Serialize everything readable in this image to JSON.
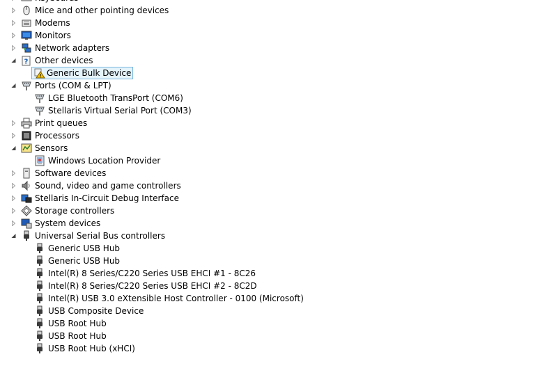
{
  "tree": [
    {
      "label": "Keyboards",
      "level": 0,
      "expander": "collapsed",
      "icon": "keyboard-icon"
    },
    {
      "label": "Mice and other pointing devices",
      "level": 0,
      "expander": "collapsed",
      "icon": "mouse-icon"
    },
    {
      "label": "Modems",
      "level": 0,
      "expander": "collapsed",
      "icon": "modem-icon"
    },
    {
      "label": "Monitors",
      "level": 0,
      "expander": "collapsed",
      "icon": "monitor-icon"
    },
    {
      "label": "Network adapters",
      "level": 0,
      "expander": "collapsed",
      "icon": "network-adapter-icon"
    },
    {
      "label": "Other devices",
      "level": 0,
      "expander": "expanded",
      "icon": "unknown-device-icon"
    },
    {
      "label": "Generic Bulk Device",
      "level": 1,
      "expander": "none",
      "icon": "warning-device-icon",
      "selected": true
    },
    {
      "label": "Ports (COM & LPT)",
      "level": 0,
      "expander": "expanded",
      "icon": "port-icon"
    },
    {
      "label": "LGE Bluetooth TransPort (COM6)",
      "level": 1,
      "expander": "none",
      "icon": "port-icon"
    },
    {
      "label": "Stellaris Virtual Serial Port (COM3)",
      "level": 1,
      "expander": "none",
      "icon": "port-icon"
    },
    {
      "label": "Print queues",
      "level": 0,
      "expander": "collapsed",
      "icon": "printer-icon"
    },
    {
      "label": "Processors",
      "level": 0,
      "expander": "collapsed",
      "icon": "processor-icon"
    },
    {
      "label": "Sensors",
      "level": 0,
      "expander": "expanded",
      "icon": "sensor-icon"
    },
    {
      "label": "Windows Location Provider",
      "level": 1,
      "expander": "none",
      "icon": "location-sensor-icon"
    },
    {
      "label": "Software devices",
      "level": 0,
      "expander": "collapsed",
      "icon": "software-device-icon"
    },
    {
      "label": "Sound, video and game controllers",
      "level": 0,
      "expander": "collapsed",
      "icon": "speaker-icon"
    },
    {
      "label": "Stellaris In-Circuit Debug Interface",
      "level": 0,
      "expander": "collapsed",
      "icon": "debug-interface-icon"
    },
    {
      "label": "Storage controllers",
      "level": 0,
      "expander": "collapsed",
      "icon": "storage-controller-icon"
    },
    {
      "label": "System devices",
      "level": 0,
      "expander": "collapsed",
      "icon": "system-device-icon"
    },
    {
      "label": "Universal Serial Bus controllers",
      "level": 0,
      "expander": "expanded",
      "icon": "usb-icon"
    },
    {
      "label": "Generic USB Hub",
      "level": 1,
      "expander": "none",
      "icon": "usb-icon"
    },
    {
      "label": "Generic USB Hub",
      "level": 1,
      "expander": "none",
      "icon": "usb-icon"
    },
    {
      "label": "Intel(R) 8 Series/C220 Series USB EHCI #1 - 8C26",
      "level": 1,
      "expander": "none",
      "icon": "usb-icon"
    },
    {
      "label": "Intel(R) 8 Series/C220 Series USB EHCI #2 - 8C2D",
      "level": 1,
      "expander": "none",
      "icon": "usb-icon"
    },
    {
      "label": "Intel(R) USB 3.0 eXtensible Host Controller - 0100 (Microsoft)",
      "level": 1,
      "expander": "none",
      "icon": "usb-icon"
    },
    {
      "label": "USB Composite Device",
      "level": 1,
      "expander": "none",
      "icon": "usb-icon"
    },
    {
      "label": "USB Root Hub",
      "level": 1,
      "expander": "none",
      "icon": "usb-icon"
    },
    {
      "label": "USB Root Hub",
      "level": 1,
      "expander": "none",
      "icon": "usb-icon"
    },
    {
      "label": "USB Root Hub (xHCI)",
      "level": 1,
      "expander": "none",
      "icon": "usb-icon"
    }
  ]
}
